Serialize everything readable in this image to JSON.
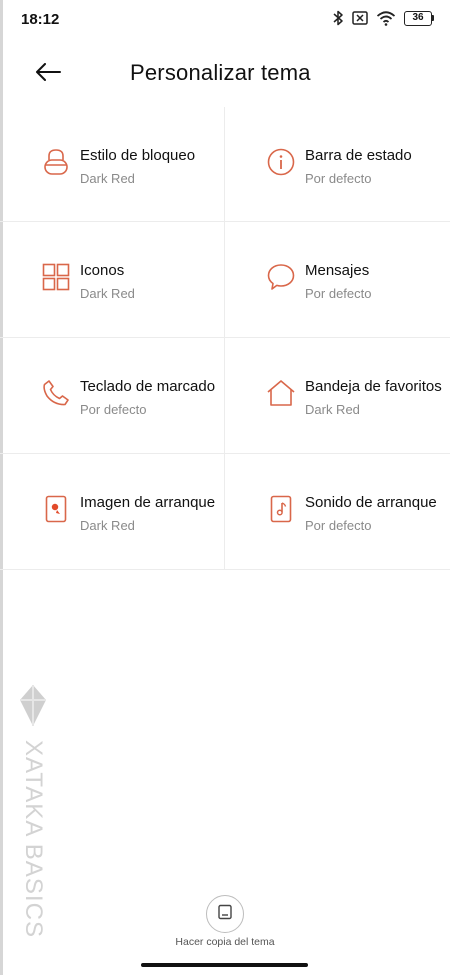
{
  "status_bar": {
    "time": "18:12",
    "battery_level": "36",
    "icons": [
      "bluetooth-icon",
      "sim-off-icon",
      "wifi-icon",
      "battery-icon"
    ]
  },
  "header": {
    "title": "Personalizar tema",
    "back_icon": "arrow-left-icon"
  },
  "accent_color": "#d9674a",
  "items": [
    {
      "title": "Estilo de bloqueo",
      "subtitle": "Dark Red",
      "icon": "lock-icon"
    },
    {
      "title": "Barra de estado",
      "subtitle": "Por defecto",
      "icon": "info-icon"
    },
    {
      "title": "Iconos",
      "subtitle": "Dark Red",
      "icon": "grid-icon"
    },
    {
      "title": "Mensajes",
      "subtitle": "Por defecto",
      "icon": "message-bubble-icon"
    },
    {
      "title": "Teclado de marcado",
      "subtitle": "Por defecto",
      "icon": "phone-icon"
    },
    {
      "title": "Bandeja de favoritos",
      "subtitle": "Dark Red",
      "icon": "home-icon"
    },
    {
      "title": "Imagen de arranque",
      "subtitle": "Dark Red",
      "icon": "boot-image-icon"
    },
    {
      "title": "Sonido de arranque",
      "subtitle": "Por defecto",
      "icon": "boot-sound-icon"
    }
  ],
  "watermark": {
    "text": "XATAKA BASICS"
  },
  "footer": {
    "backup_label": "Hacer copia del tema",
    "backup_icon": "save-icon"
  }
}
